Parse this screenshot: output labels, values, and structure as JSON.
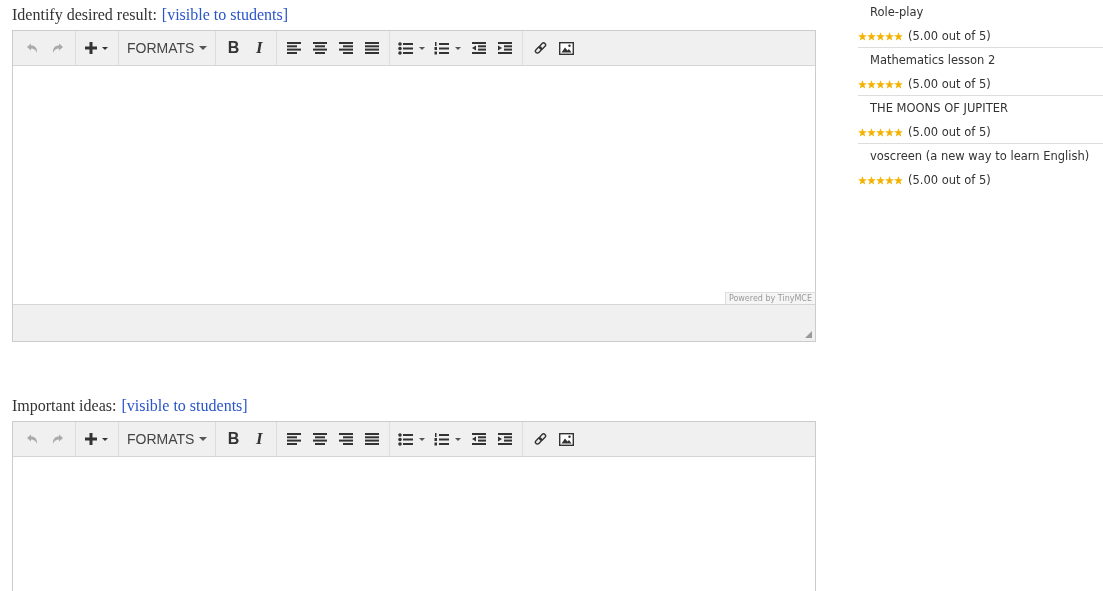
{
  "editors": [
    {
      "label": "Identify desired result:",
      "tag": "[visible to students]",
      "toolbar": {
        "formats": "FORMATS",
        "bold": "B",
        "italic": "I"
      },
      "powered_by": "Powered by TinyMCE"
    },
    {
      "label": "Important ideas:",
      "tag": "[visible to students]",
      "toolbar": {
        "formats": "FORMATS",
        "bold": "B",
        "italic": "I"
      }
    }
  ],
  "sidebar": {
    "items": [
      {
        "title": "Role-play",
        "stars": 5,
        "rating": "(5.00 out of 5)"
      },
      {
        "title": "Mathematics lesson 2",
        "stars": 5,
        "rating": "(5.00 out of 5)"
      },
      {
        "title": "THE MOONS OF JUPITER",
        "stars": 5,
        "rating": "(5.00 out of 5)"
      },
      {
        "title": "voscreen (a new way to learn English)",
        "stars": 5,
        "rating": "(5.00 out of 5)"
      }
    ]
  }
}
